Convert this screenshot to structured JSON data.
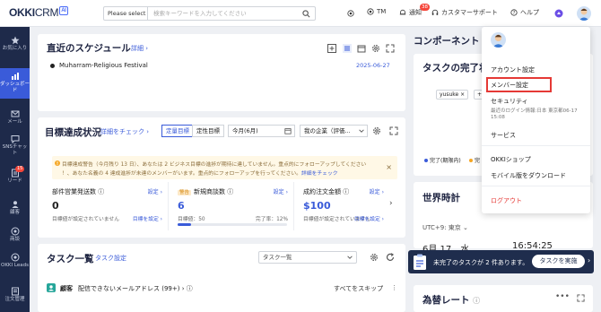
{
  "brand": {
    "okki": "OKKI",
    "crm": "CRM",
    "ai": "AI"
  },
  "search": {
    "scope": "Please select",
    "placeholder": "検索キーワードを入力してください"
  },
  "topbar": {
    "tm": "TM",
    "notice": "通知",
    "notice_count": "38",
    "support": "カスタマーサポート",
    "help": "ヘルプ"
  },
  "sidebar": {
    "items": [
      {
        "label": "お気に入り"
      },
      {
        "label": "ダッシュボード"
      },
      {
        "label": "メール"
      },
      {
        "label": "SNSチャット"
      },
      {
        "label": "リード",
        "badge": "15"
      },
      {
        "label": "顧客"
      },
      {
        "label": "商談"
      },
      {
        "label": "OKKI Leads"
      },
      {
        "label": "注文管理"
      }
    ]
  },
  "schedule": {
    "title": "直近のスケジュール",
    "detail": "詳細",
    "event": "Muharram-Religious Festival",
    "date": "2025-06-27"
  },
  "components": {
    "title": "コンポーネント"
  },
  "task_completion": {
    "title": "タスクの完了状",
    "tag1": "yusuke",
    "tag2": "+3...",
    "legend_done": "完了(期限内)",
    "legend_other": "完"
  },
  "goals": {
    "title": "目標達成状況",
    "check": "詳細をチェック",
    "tab_quant": "定量目標",
    "tab_qual": "定性目標",
    "month": "今月(6月)",
    "company": "我の企業（評価...",
    "warning_line1": "目標達成警告（今月残り 13 日）、あなたは 2 ビジネス目標の進捗が期待に達していません。重点的にフォローアップしてください",
    "warning_line2": "！、あなた名義の 4 達成進捗が未達のメンバーがいます。重点的にフォローアップを行ってください。",
    "warning_link": "詳細をチェック",
    "metrics": [
      {
        "title": "部件営業発送数",
        "setting": "設定",
        "value": "0",
        "note": "目標値が設定されていません",
        "link": "目標を設定"
      },
      {
        "title": "新規商談数",
        "warn": "警告",
        "setting": "設定",
        "value": "6",
        "note": "目標値：50",
        "rate": "完了率：12%",
        "progress": 0.12
      },
      {
        "title": "成約注文金額",
        "setting": "設定",
        "value": "$100",
        "note": "目標値が設定されていません",
        "link": "目標を設定"
      }
    ]
  },
  "world_clock": {
    "title": "世界時計",
    "tz": "UTC+9: 東京",
    "date": "6月 17　水",
    "time": "16:54:25"
  },
  "tasks": {
    "title": "タスク一覧",
    "setting": "タスク設定",
    "select": "タスク一覧"
  },
  "customer_row": {
    "label": "顧客",
    "desc": "配信できないメールアドレス (99+)",
    "skip": "すべてをスキップ"
  },
  "exchange": {
    "title": "為替レート"
  },
  "menu": {
    "account": "アカウント設定",
    "member": "メンバー設定",
    "security": "セキュリティ",
    "last_login": "最近のログイン情報:日本 東京都06-17",
    "last_login2": "15:08",
    "service": "サービス",
    "shop": "OKKIショップ",
    "mobile": "モバイル版をダウンロード",
    "logout": "ログアウト"
  },
  "toast": {
    "text": "未完了のタスクが 2 件あります。",
    "button": "タスクを実施"
  },
  "colors": {
    "accent": "#3a5bd9",
    "sidebar": "#1e2a4a",
    "danger": "#e53935",
    "warn": "#f5a623"
  }
}
